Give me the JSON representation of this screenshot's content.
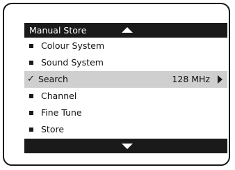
{
  "menu": {
    "title": "Manual Store",
    "items": [
      {
        "label": "Colour System",
        "value": ""
      },
      {
        "label": "Sound System",
        "value": ""
      },
      {
        "label": "Search",
        "value": "128 MHz"
      },
      {
        "label": "Channel",
        "value": ""
      },
      {
        "label": "Fine Tune",
        "value": ""
      },
      {
        "label": "Store",
        "value": ""
      }
    ],
    "selected_index": 2,
    "selected_marker": "✓",
    "icons": {
      "scroll_up": "up-triangle-icon",
      "scroll_down": "down-triangle-icon",
      "submenu": "right-triangle-icon",
      "bullet": "square-bullet-icon",
      "check": "checkmark-icon"
    },
    "colors": {
      "bar": "#1a1a1a",
      "highlight": "#cfcfcf",
      "text": "#111111",
      "inverse_text": "#ffffff"
    }
  }
}
